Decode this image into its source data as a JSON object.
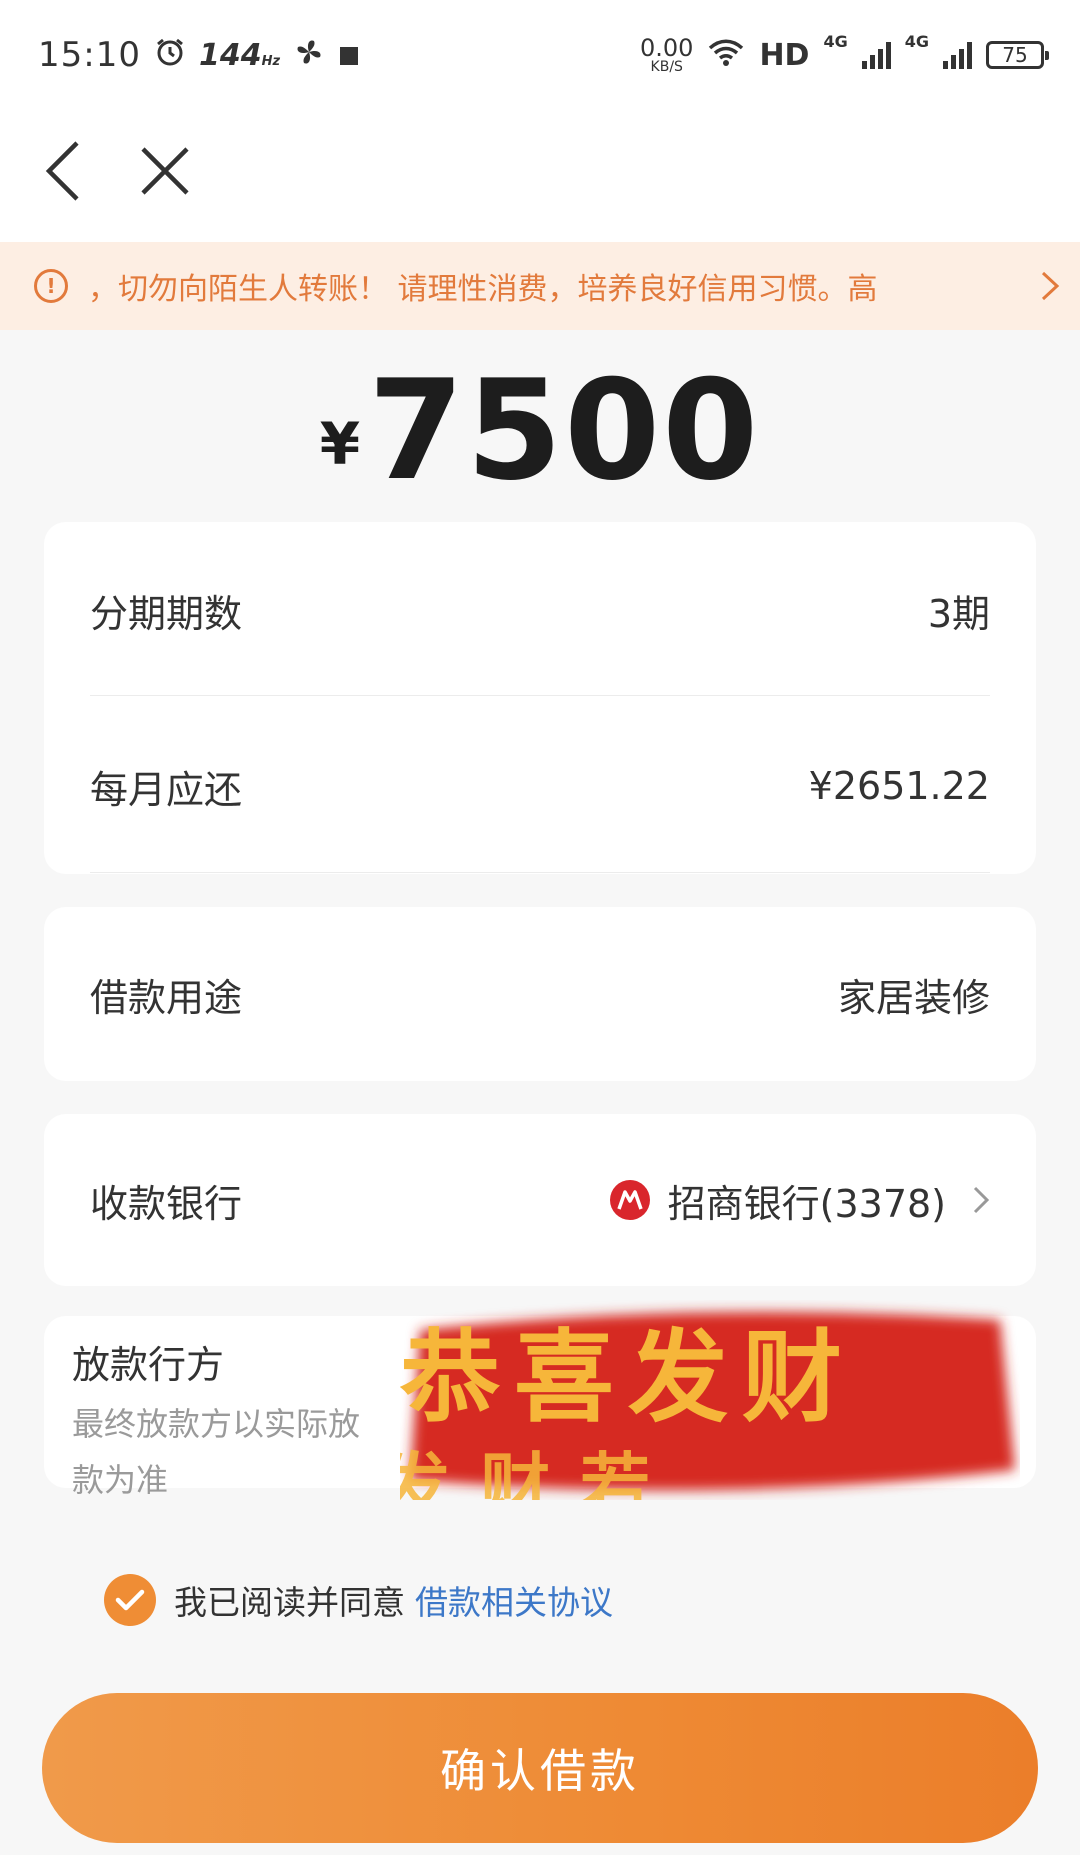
{
  "status_bar": {
    "time": "15:10",
    "refresh_rate": "144",
    "refresh_unit": "Hz",
    "net_speed_value": "0.00",
    "net_speed_unit": "KB/S",
    "hd_label": "HD",
    "network_1": "4G",
    "network_2": "4G",
    "battery": "75",
    "icons": [
      "alarm-icon",
      "fan-icon",
      "square-icon",
      "wifi-icon",
      "signal-icon",
      "battery-icon"
    ]
  },
  "nav": {
    "back_icon": "back-arrow-icon",
    "close_icon": "close-icon"
  },
  "notice": {
    "icon": "warning-circle-icon",
    "text": "，切勿向陌生人转账！ 请理性消费，培养良好信用习惯。高"
  },
  "amount": {
    "currency": "¥",
    "value": "7500"
  },
  "details": {
    "installments_label": "分期期数",
    "installments_value": "3期",
    "monthly_label": "每月应还",
    "monthly_value": "¥2651.22",
    "purpose_label": "借款用途",
    "purpose_value": "家居装修",
    "bank_label": "收款银行",
    "bank_value": "招商银行(3378)",
    "lender_title": "放款行方",
    "lender_subtitle": "最终放款方以实际放款为准",
    "lender_sticker_text": "恭喜发财"
  },
  "agreement": {
    "prefix": "我已阅读并同意",
    "link": "借款相关协议",
    "checked": true
  },
  "confirm_button": "确认借款",
  "colors": {
    "accent": "#ef8d35",
    "notice_bg": "#fdeee3",
    "notice_text": "#e27a3c",
    "link": "#3d78c8",
    "bank_logo": "#d9262c"
  }
}
